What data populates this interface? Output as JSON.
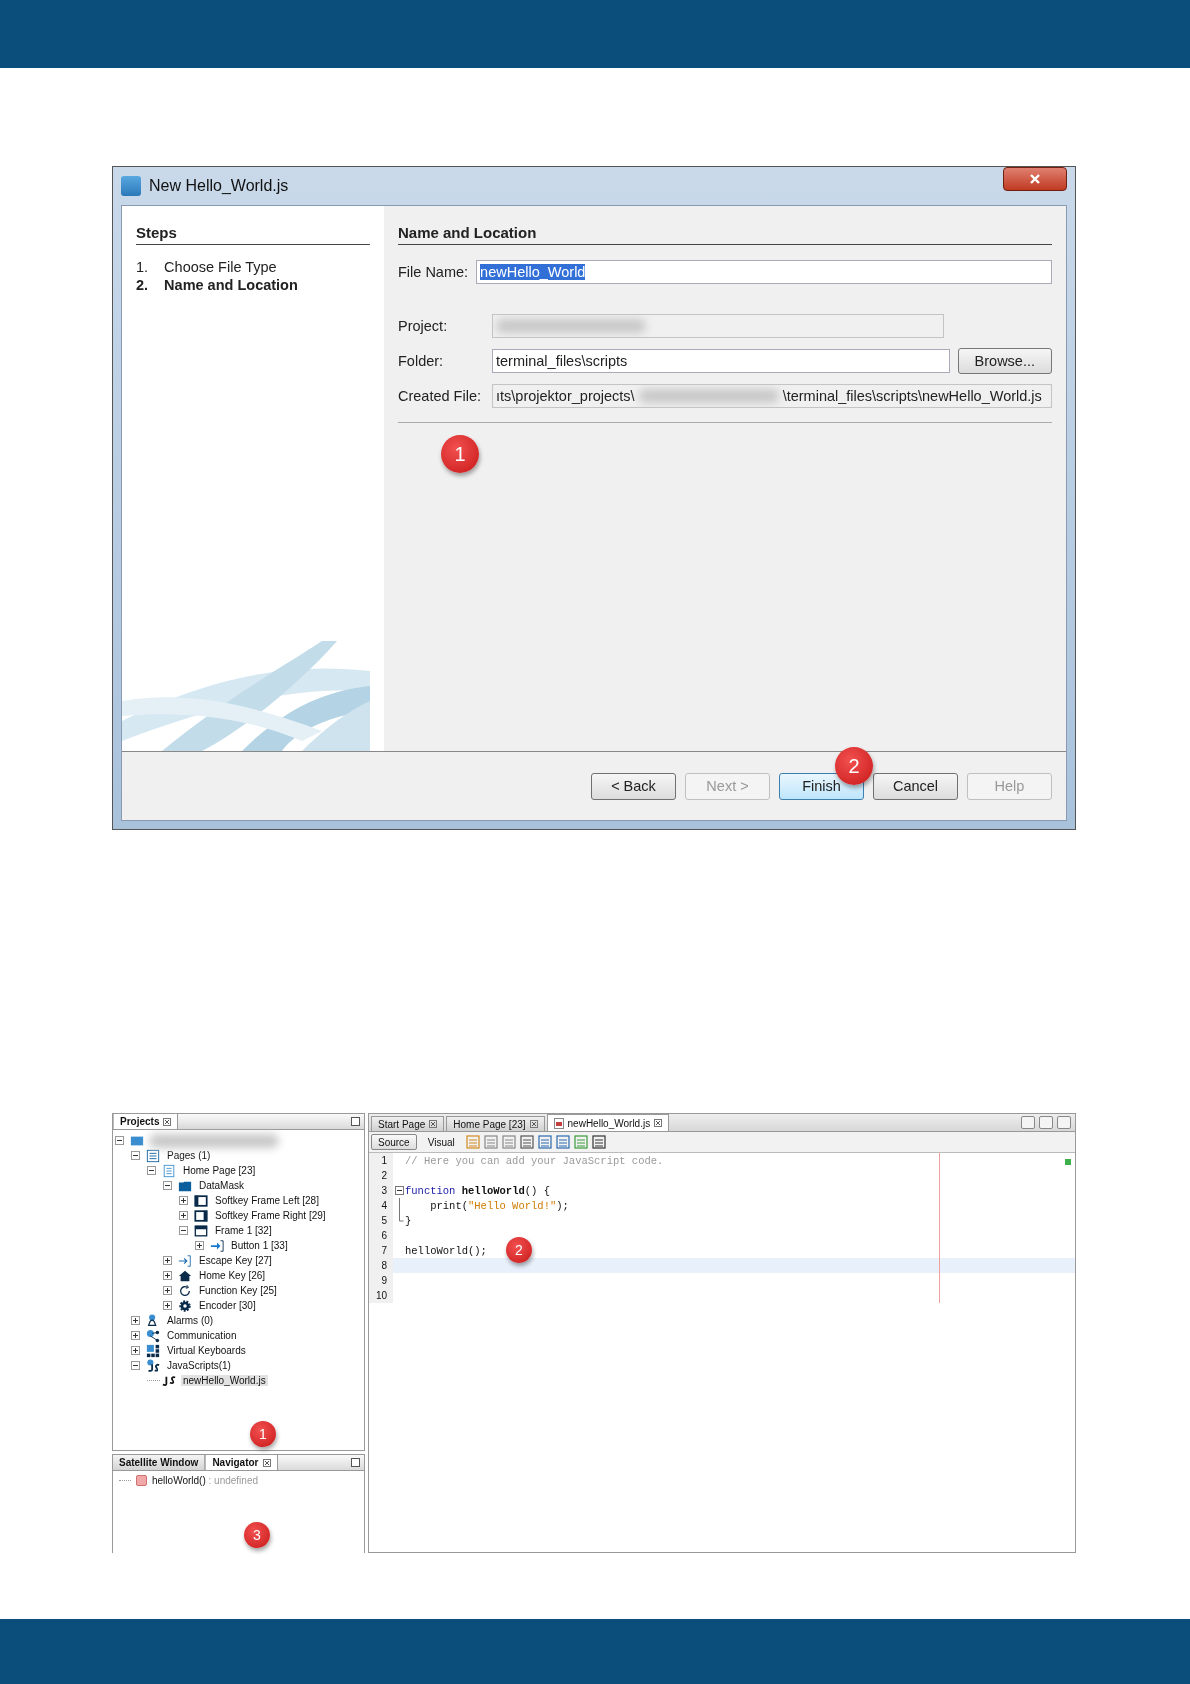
{
  "dialog": {
    "title": "New Hello_World.js",
    "steps_heading": "Steps",
    "steps": [
      {
        "number": "1.",
        "label": "Choose File Type",
        "selected": false
      },
      {
        "number": "2.",
        "label": "Name and Location",
        "selected": true
      }
    ],
    "section_heading": "Name and Location",
    "fields": [
      {
        "kind": "text",
        "label": "File Name:",
        "value": "newHello_World",
        "highlighted": true
      },
      {
        "kind": "redacted",
        "label": "Project:",
        "disabled": true
      },
      {
        "kind": "browse",
        "label": "Folder:",
        "value": "terminal_files\\scripts",
        "button": "Browse..."
      },
      {
        "kind": "path",
        "label": "Created File:",
        "value_start": "ıts\\projektor_projects\\",
        "value_end": "\\terminal_files\\scripts\\newHello_World.js",
        "disabled": true
      }
    ],
    "buttons": [
      {
        "label": "< Back",
        "disabled": false,
        "default": false
      },
      {
        "label": "Next >",
        "disabled": true,
        "default": false
      },
      {
        "label": "Finish",
        "disabled": false,
        "default": true
      },
      {
        "label": "Cancel",
        "disabled": false,
        "default": false
      },
      {
        "label": "Help",
        "disabled": true,
        "default": false
      }
    ],
    "callouts": [
      {
        "label": "1"
      },
      {
        "label": "2"
      }
    ]
  },
  "ide": {
    "projects_tab": "Projects",
    "tree": [
      {
        "kind": "project",
        "expanded": true,
        "children": [
          {
            "label": "Pages (1)",
            "kind": "pages",
            "expanded": true,
            "selected": false,
            "children": [
              {
                "label": "Home Page [23]",
                "kind": "page",
                "expanded": true,
                "selected": false,
                "children": [
                  {
                    "label": "DataMask",
                    "kind": "folder",
                    "expanded": true,
                    "selected": false,
                    "children": [
                      {
                        "label": "Softkey Frame Left [28]",
                        "kind": "frame-left",
                        "expanded": false,
                        "selected": false
                      },
                      {
                        "label": "Softkey Frame Right [29]",
                        "kind": "frame-right",
                        "expanded": false,
                        "selected": false
                      },
                      {
                        "label": "Frame 1 [32]",
                        "kind": "frame",
                        "expanded": true,
                        "selected": false,
                        "children": [
                          {
                            "label": "Button 1 [33]",
                            "kind": "arrow",
                            "expanded": false,
                            "selected": false
                          }
                        ]
                      }
                    ]
                  },
                  {
                    "label": "Escape Key [27]",
                    "kind": "escape",
                    "expanded": false,
                    "selected": false
                  },
                  {
                    "label": "Home Key [26]",
                    "kind": "home",
                    "expanded": false,
                    "selected": false
                  },
                  {
                    "label": "Function Key [25]",
                    "kind": "refresh",
                    "expanded": false,
                    "selected": false
                  },
                  {
                    "label": "Encoder [30]",
                    "kind": "gear",
                    "expanded": false,
                    "selected": false
                  }
                ]
              }
            ]
          },
          {
            "label": "Alarms (0)",
            "kind": "bell",
            "expanded": false,
            "selected": false
          },
          {
            "label": "Communication",
            "kind": "share",
            "expanded": false,
            "selected": false
          },
          {
            "label": "Virtual Keyboards",
            "kind": "grid",
            "expanded": false,
            "selected": false
          },
          {
            "label": "JavaScripts(1)",
            "kind": "js-folder",
            "expanded": true,
            "selected": false,
            "children": [
              {
                "label": "newHello_World.js",
                "kind": "js",
                "selected": true
              }
            ]
          }
        ]
      }
    ],
    "bottom_tabs": [
      {
        "label": "Satellite Window",
        "selected": false,
        "closable": false
      },
      {
        "label": "Navigator",
        "selected": true,
        "closable": true
      }
    ],
    "navigator": [
      {
        "name": "helloWorld()",
        "type": " : undefined"
      }
    ],
    "editor_tabs": [
      {
        "label": "Start Page",
        "selected": false,
        "kind": "page"
      },
      {
        "label": "Home Page [23]",
        "selected": false,
        "kind": "page"
      },
      {
        "label": "newHello_World.js",
        "selected": true,
        "kind": "file"
      }
    ],
    "view_buttons": [
      {
        "label": "Source",
        "selected": true
      },
      {
        "label": "Visual",
        "selected": false
      }
    ],
    "code": [
      {
        "number": "1",
        "current": false,
        "kind": "plain",
        "segments": [
          {
            "kind": "comment",
            "text": "// Here you can add your JavaScript code."
          }
        ]
      },
      {
        "number": "2",
        "current": false,
        "kind": "plain"
      },
      {
        "number": "3",
        "current": false,
        "kind": "fold-start",
        "segments": [
          {
            "kind": "keyword",
            "text": "function"
          },
          {
            "kind": "name",
            "text": " helloWorld"
          },
          {
            "kind": "plain",
            "text": "() {"
          }
        ]
      },
      {
        "number": "4",
        "current": false,
        "kind": "fold-body",
        "segments": [
          {
            "kind": "plain",
            "text": "    print("
          },
          {
            "kind": "string",
            "text": "\"Hello World!\""
          },
          {
            "kind": "plain",
            "text": ");"
          }
        ]
      },
      {
        "number": "5",
        "current": false,
        "kind": "fold-end",
        "segments": [
          {
            "kind": "plain",
            "text": "}"
          }
        ]
      },
      {
        "number": "6",
        "current": false,
        "kind": "plain"
      },
      {
        "number": "7",
        "current": false,
        "kind": "plain",
        "segments": [
          {
            "kind": "plain",
            "text": "helloWorld();"
          }
        ]
      },
      {
        "number": "8",
        "current": true,
        "kind": "plain"
      },
      {
        "number": "9",
        "current": false,
        "kind": "plain"
      },
      {
        "number": "10",
        "current": false,
        "kind": "plain"
      }
    ],
    "callouts": [
      {
        "label": "1"
      },
      {
        "label": "2"
      },
      {
        "label": "3"
      }
    ]
  }
}
